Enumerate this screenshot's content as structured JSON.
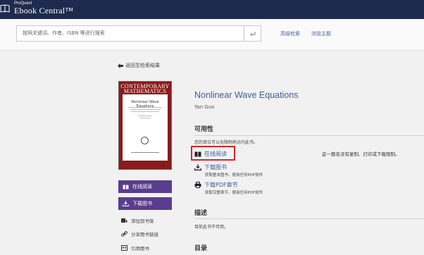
{
  "header": {
    "brand_small": "ProQuest",
    "brand_large": "Ebook Central™"
  },
  "search": {
    "placeholder": "按照关键词、作者、ISBN 等进行搜索",
    "advanced_label": "高级检索",
    "browse_label": "浏览主题"
  },
  "nav": {
    "back_label": "返回至检索结果"
  },
  "cover": {
    "series_line1": "CONTEMPORARY",
    "series_line2": "MATHEMATICS",
    "book_title": "Nonlinear Wave Equations"
  },
  "sidebar": {
    "read_online_label": "在线阅读",
    "download_label": "下载图书",
    "add_shelf_label": "添加到书架",
    "share_label": "分享图书链接",
    "cite_label": "引用图书"
  },
  "book": {
    "title": "Nonlinear Wave Equations",
    "author": "Yan Guo"
  },
  "availability": {
    "heading": "可用性",
    "access_note": "您的单位可以无限制地访问此书。",
    "read_online_label": "在线阅读",
    "download_book_label": "下载图书",
    "download_book_note": "获取整本图书，使用任何PDF软件",
    "download_chapter_label": "下载PDF章节",
    "download_chapter_note": "获取完整章节，使用任何PDF软件",
    "no_limit_note": "这一题名没有复制、打印或下载限制。"
  },
  "description": {
    "heading": "描述",
    "text": "目前此书不可用。"
  },
  "toc": {
    "heading": "目录"
  }
}
